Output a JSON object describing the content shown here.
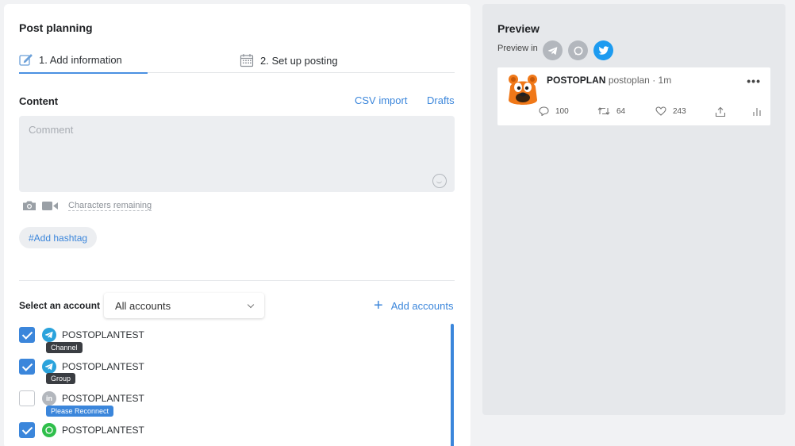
{
  "left": {
    "title": "Post planning",
    "tabs": [
      {
        "label": "1. Add information",
        "active": true
      },
      {
        "label": "2. Set up posting",
        "active": false
      }
    ],
    "content": {
      "label": "Content",
      "csv_import": "CSV import",
      "drafts": "Drafts",
      "comment_placeholder": "Comment",
      "chars_remaining": "Characters remaining",
      "hashtag_button": "#Add hashtag"
    },
    "accounts": {
      "select_label": "Select an account",
      "select_value": "All accounts",
      "add_accounts": "Add accounts",
      "items": [
        {
          "name": "POSTOPLANTEST",
          "network": "telegram",
          "tag": "Channel",
          "checked": true
        },
        {
          "name": "POSTOPLANTEST",
          "network": "telegram",
          "tag": "Group",
          "checked": true
        },
        {
          "name": "POSTOPLANTEST",
          "network": "linkedin",
          "tag": "Please Reconnect",
          "checked": false
        },
        {
          "name": "POSTOPLANTEST",
          "network": "whatsapp",
          "tag": "",
          "checked": true
        }
      ]
    }
  },
  "right": {
    "title": "Preview",
    "preview_in": "Preview in",
    "networks": [
      "telegram-icon",
      "whatsapp-icon",
      "twitter-icon"
    ],
    "tweet": {
      "display_name": "POSTOPLAN",
      "handle": "postoplan · 1m",
      "more": "•••",
      "replies": "100",
      "retweets": "64",
      "likes": "243"
    }
  },
  "colors": {
    "accent": "#3b86db",
    "telegram": "#2aa3dc",
    "whatsapp": "#2fbf4b",
    "twitter": "#1d9bf0",
    "inactive_icon": "#b3b7bd",
    "mascot": "#f07818"
  }
}
